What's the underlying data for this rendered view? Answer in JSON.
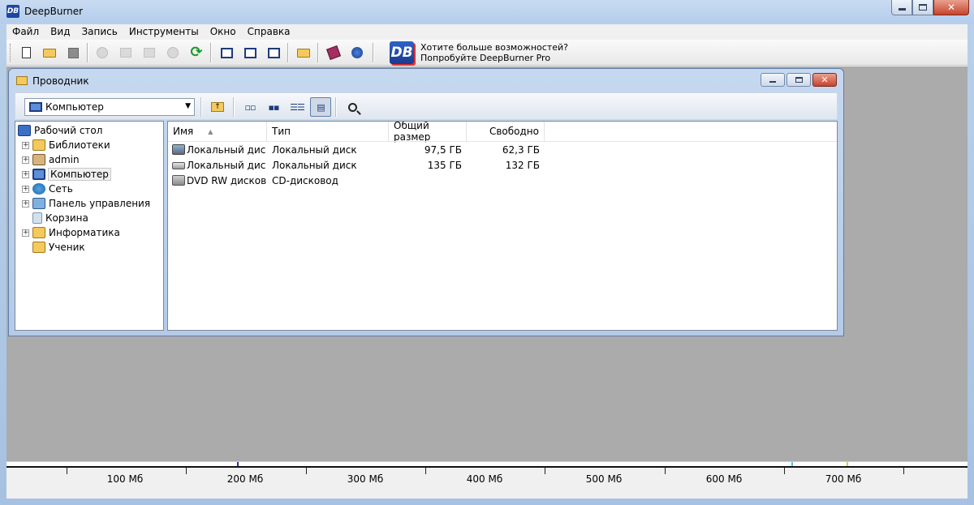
{
  "app": {
    "title": "DeepBurner",
    "logo_text": "DB"
  },
  "menu": [
    "Файл",
    "Вид",
    "Запись",
    "Инструменты",
    "Окно",
    "Справка"
  ],
  "toolbar": {
    "promo_line1": "Хотите больше возможностей?",
    "promo_line2": "Попробуйте DeepBurner Pro",
    "logo_text": "DB"
  },
  "explorer": {
    "title": "Проводник",
    "location": "Компьютер",
    "tree": [
      {
        "label": "Рабочий стол",
        "icon": "desktop-icon"
      },
      {
        "label": "Библиотеки",
        "icon": "libraries-icon"
      },
      {
        "label": "admin",
        "icon": "user-folder-icon"
      },
      {
        "label": "Компьютер",
        "icon": "computer-icon"
      },
      {
        "label": "Сеть",
        "icon": "network-icon"
      },
      {
        "label": "Панель управления",
        "icon": "control-panel-icon"
      },
      {
        "label": "Корзина",
        "icon": "recycle-bin-icon"
      },
      {
        "label": "Информатика",
        "icon": "folder-icon"
      },
      {
        "label": "Ученик",
        "icon": "folder-icon"
      }
    ],
    "columns": {
      "name": "Имя",
      "type": "Тип",
      "total": "Общий размер",
      "free": "Свободно"
    },
    "rows": [
      {
        "name": "Локальный дис...",
        "type": "Локальный диск",
        "total": "97,5 ГБ",
        "free": "62,3 ГБ",
        "icon": "system-drive-icon"
      },
      {
        "name": "Локальный дис...",
        "type": "Локальный диск",
        "total": "135 ГБ",
        "free": "132 ГБ",
        "icon": "hard-drive-icon"
      },
      {
        "name": "DVD RW дисков...",
        "type": "CD-дисковод",
        "total": "",
        "free": "",
        "icon": "dvd-drive-icon"
      }
    ]
  },
  "capacity": {
    "labels": [
      "100 Мб",
      "200 Мб",
      "300 Мб",
      "400 Мб",
      "500 Мб",
      "600 Мб",
      "700 Мб"
    ],
    "marker_colors": [
      "#1d3b9e",
      "#4fc3f7",
      "#f2c230"
    ]
  }
}
